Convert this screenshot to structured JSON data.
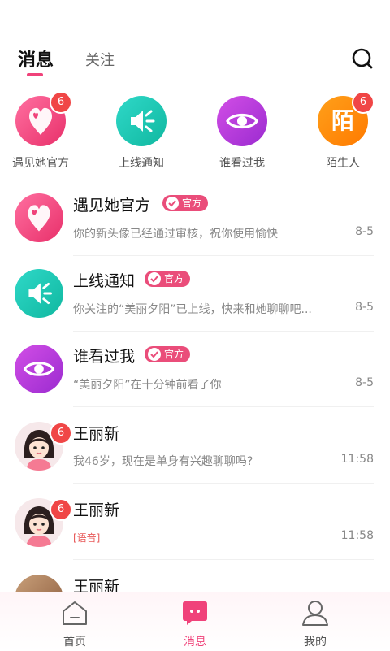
{
  "header": {
    "tabs": [
      {
        "label": "消息",
        "active": true
      },
      {
        "label": "关注",
        "active": false
      }
    ],
    "search_icon": "search-icon"
  },
  "quick_entries": [
    {
      "label": "遇见她官方",
      "badge": "6",
      "icon": "heart-location-icon",
      "color": "#f0427a"
    },
    {
      "label": "上线通知",
      "badge": "",
      "icon": "speaker-icon",
      "color": "#19c9b0"
    },
    {
      "label": "谁看过我",
      "badge": "",
      "icon": "eye-icon",
      "color": "#b83de0"
    },
    {
      "label": "陌生人",
      "badge": "6",
      "icon": "stranger-icon",
      "glyph": "陌",
      "color": "#ff8a00"
    }
  ],
  "conversations": [
    {
      "name": "遇见她官方",
      "tag": "官方",
      "preview": "你的新头像已经通过审核，祝你使用愉快",
      "time": "8-5"
    },
    {
      "name": "上线通知",
      "tag": "官方",
      "preview": "你关注的“美丽夕阳”已上线，快来和她聊聊吧...",
      "time": "8-5"
    },
    {
      "name": "谁看过我",
      "tag": "官方",
      "preview": "“美丽夕阳”在十分钟前看了你",
      "time": "8-5"
    },
    {
      "name": "王丽新",
      "badge": "6",
      "preview": "我46岁，现在是单身有兴趣聊聊吗?",
      "time": "11:58"
    },
    {
      "name": "王丽新",
      "badge": "6",
      "preview": "[语音]",
      "time": "11:58"
    },
    {
      "name": "王丽新",
      "preview": "",
      "time": ""
    }
  ],
  "bottom_nav": [
    {
      "label": "首页",
      "icon": "home-icon",
      "active": false
    },
    {
      "label": "消息",
      "icon": "message-icon",
      "active": true
    },
    {
      "label": "我的",
      "icon": "profile-icon",
      "active": false
    }
  ],
  "colors": {
    "accent": "#f0427a",
    "badge": "#f04646",
    "tag": "#ea4d7a"
  }
}
